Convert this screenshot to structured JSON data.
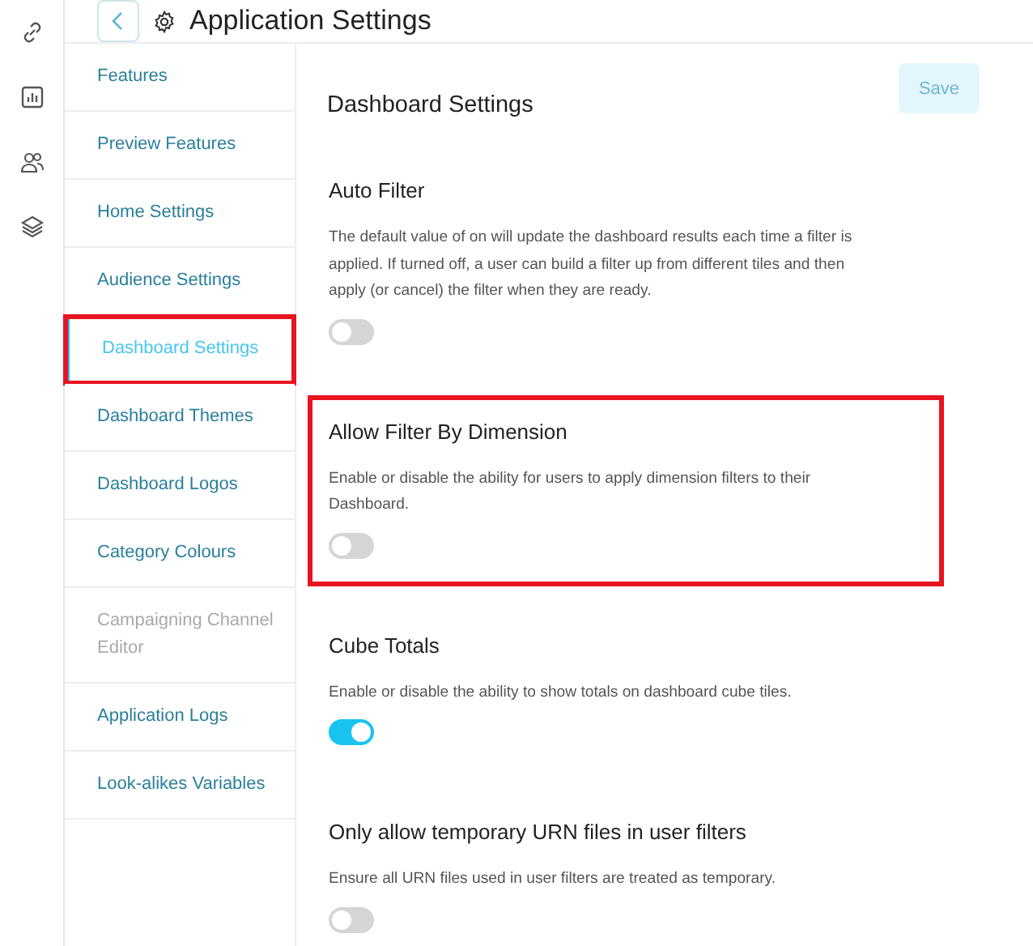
{
  "header": {
    "title": "Application Settings"
  },
  "rail_icons": [
    {
      "kind": "link"
    },
    {
      "kind": "chart"
    },
    {
      "kind": "people"
    },
    {
      "kind": "layers"
    }
  ],
  "nav": [
    {
      "label": "Features",
      "selected": false,
      "disabled": false,
      "highlighted": false
    },
    {
      "label": "Preview Features",
      "selected": false,
      "disabled": false,
      "highlighted": false
    },
    {
      "label": "Home Settings",
      "selected": false,
      "disabled": false,
      "highlighted": false
    },
    {
      "label": "Audience Settings",
      "selected": false,
      "disabled": false,
      "highlighted": false
    },
    {
      "label": "Dashboard Settings",
      "selected": true,
      "disabled": false,
      "highlighted": true
    },
    {
      "label": "Dashboard Themes",
      "selected": false,
      "disabled": false,
      "highlighted": false
    },
    {
      "label": "Dashboard Logos",
      "selected": false,
      "disabled": false,
      "highlighted": false
    },
    {
      "label": "Category Colours",
      "selected": false,
      "disabled": false,
      "highlighted": false
    },
    {
      "label": "Campaigning Channel Editor",
      "selected": false,
      "disabled": true,
      "highlighted": false
    },
    {
      "label": "Application Logs",
      "selected": false,
      "disabled": false,
      "highlighted": false
    },
    {
      "label": "Look-alikes Variables",
      "selected": false,
      "disabled": false,
      "highlighted": false
    }
  ],
  "content": {
    "title": "Dashboard Settings",
    "save_button": {
      "label": "Save",
      "disabled": true
    },
    "settings": [
      {
        "title": "Auto Filter",
        "description": "The default value of on will update the dashboard results each time a filter is applied. If turned off, a user can build a filter up from different tiles and then apply (or cancel) the filter when they are ready.",
        "on": false,
        "highlighted": false
      },
      {
        "title": "Allow Filter By Dimension",
        "description": "Enable or disable the ability for users to apply dimension filters to their Dashboard.",
        "on": false,
        "highlighted": true
      },
      {
        "title": "Cube Totals",
        "description": "Enable or disable the ability to show totals on dashboard cube tiles.",
        "on": true,
        "highlighted": false
      },
      {
        "title": "Only allow temporary URN files in user filters",
        "description": "Ensure all URN files used in user filters are treated as temporary.",
        "on": false,
        "highlighted": false
      }
    ]
  }
}
